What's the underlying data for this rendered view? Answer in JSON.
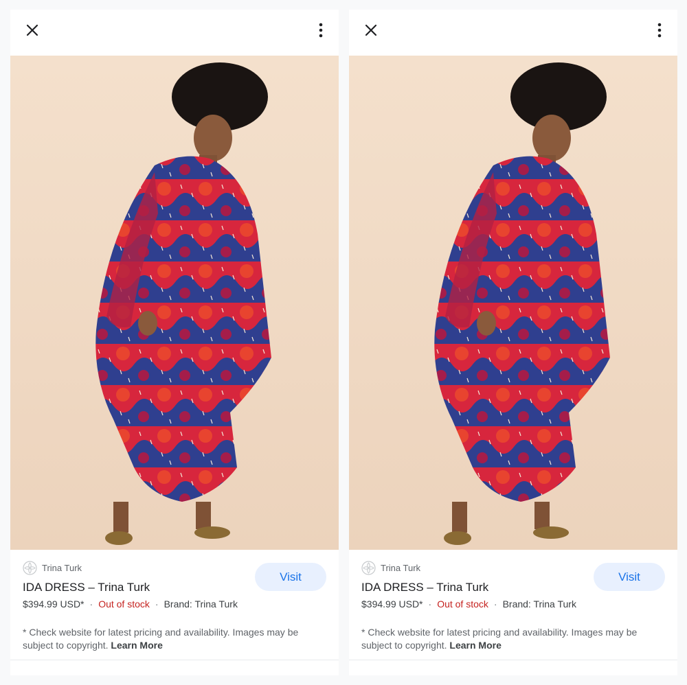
{
  "panels": [
    {
      "close_icon": "close-icon",
      "more_icon": "more-vert-icon",
      "brand": {
        "icon": "brand-logo",
        "name": "Trina Turk"
      },
      "product": {
        "title": "IDA DRESS – Trina Turk",
        "price": "$394.99 USD*",
        "separator": "·",
        "availability": "Out of stock",
        "brand_line": "Brand: Trina Turk"
      },
      "visit_label": "Visit",
      "disclaimer": "* Check website for latest pricing and availability. Images may be subject to copyright.",
      "learn_more": "Learn More"
    },
    {
      "close_icon": "close-icon",
      "more_icon": "more-vert-icon",
      "brand": {
        "icon": "brand-logo",
        "name": "Trina Turk"
      },
      "product": {
        "title": "IDA DRESS – Trina Turk",
        "price": "$394.99 USD*",
        "separator": "·",
        "availability": "Out of stock",
        "brand_line": "Brand: Trina Turk"
      },
      "visit_label": "Visit",
      "disclaimer": "* Check website for latest pricing and availability. Images may be subject to copyright.",
      "learn_more": "Learn More"
    }
  ],
  "colors": {
    "accent": "#1a73e8",
    "visit_bg": "#e8f0fe",
    "out_of_stock": "#c5221f",
    "photo_bg": "#f2dcc7"
  }
}
